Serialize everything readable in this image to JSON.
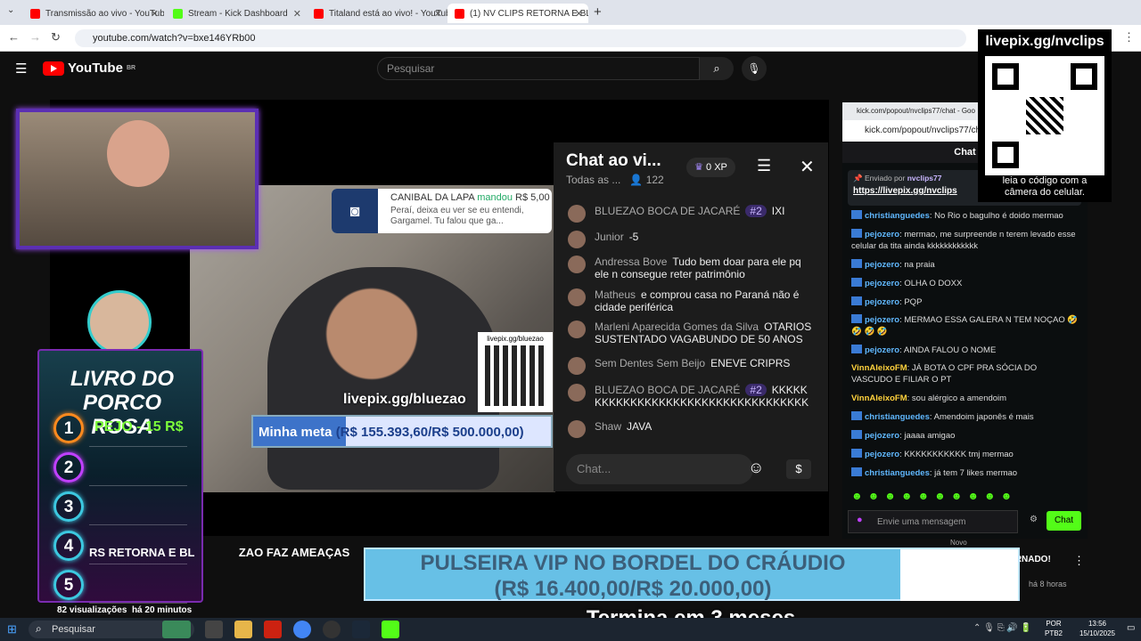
{
  "browser": {
    "tabs": [
      {
        "label": "Transmissão ao vivo - YouTube",
        "color": "#ff0000"
      },
      {
        "label": "Stream - Kick Dashboard",
        "color": "#53fc18"
      },
      {
        "label": "Titaland está ao vivo! - YouTube",
        "color": "#ff0000"
      },
      {
        "label": "(1) NV CLIPS RETORNA E BL",
        "color": "#ff0000"
      }
    ],
    "url": "youtube.com/watch?v=bxe146YRb00"
  },
  "youtube": {
    "logo": "YouTube",
    "region": "BR",
    "search_placeholder": "Pesquisar"
  },
  "video": {
    "donation": {
      "name": "CANIBAL DA LAPA",
      "verb": "mandou",
      "amount": "R$ 5,00",
      "message": "Peraí, deixa eu ver se eu entendi, Gargamel. Tu falou que ga..."
    },
    "livepix_qr_label": "livepix.gg/bluezao",
    "livepix_big": "livepix.gg/bluezao",
    "meta_label": "Minha meta",
    "meta_value": "(R$ 155.393,60/R$ 500.000,00)",
    "meta_progress": 0.31
  },
  "overlay_chat": {
    "title": "Chat ao vi...",
    "subtitle": "Todas as ...",
    "viewers": "122",
    "xp": "0 XP",
    "input_placeholder": "Chat...",
    "messages": [
      {
        "name": "BLUEZAO BOCA DE JACARÉ",
        "badge": "#2",
        "text": "IXI"
      },
      {
        "name": "Junior",
        "text": "-5"
      },
      {
        "name": "Andressa Bove",
        "text": "Tudo bem doar para ele pq ele n consegue reter patrimônio"
      },
      {
        "name": "Matheus",
        "text": "e comprou casa no Paraná não é cidade periférica"
      },
      {
        "name": "Marleni Aparecida Gomes da Silva",
        "text": "OTARIOS SUSTENTADO VAGABUNDO DE 50 ANOS"
      },
      {
        "name": "Sem Dentes Sem Beijo",
        "text": "ENEVE CRIPRS"
      },
      {
        "name": "BLUEZAO BOCA DE JACARÉ",
        "badge": "#2",
        "text": "KKKKK KKKKKKKKKKKKKKKKKKKKKKKKKKKKKK"
      },
      {
        "name": "Shaw",
        "text": "JAVA"
      }
    ]
  },
  "livro": {
    "title_line1": "LIVRO DO PORCO",
    "title_line2": "ROSA",
    "ranks": [
      {
        "n": "1",
        "label": "PEJO - 15 R$",
        "color": "#ff8a1e"
      },
      {
        "n": "2",
        "label": "",
        "color": "#c040ff"
      },
      {
        "n": "3",
        "label": "",
        "color": "#3cc8e0"
      },
      {
        "n": "4",
        "label": "",
        "color": "#3cc8e0"
      },
      {
        "n": "5",
        "label": "",
        "color": "#3cc8e0"
      }
    ]
  },
  "kick": {
    "url_small": "kick.com/popout/nvclips77/chat - Goo",
    "url": "kick.com/popout/nvclips77/cha",
    "chat_header": "Chat",
    "pinned_by": "Enviado por",
    "pinned_user": "nvclips77",
    "pinned_link": "https://livepix.gg/nvclips",
    "messages": [
      {
        "user": "christianguedes",
        "color": "#60b8ff",
        "text": "No Rio o bagulho é doido mermao"
      },
      {
        "user": "pejozero",
        "color": "#60b8ff",
        "text": "mermao, me surpreende n terem levado esse celular da tita ainda kkkkkkkkkkkk"
      },
      {
        "user": "pejozero",
        "color": "#60b8ff",
        "text": "na praia"
      },
      {
        "user": "pejozero",
        "color": "#60b8ff",
        "text": "OLHA O DOXX"
      },
      {
        "user": "pejozero",
        "color": "#60b8ff",
        "text": "PQP"
      },
      {
        "user": "pejozero",
        "color": "#60b8ff",
        "text": "MERMAO ESSA GALERA N TEM NOÇAO 🤣 🤣 🤣 🤣"
      },
      {
        "user": "pejozero",
        "color": "#60b8ff",
        "text": "AINDA FALOU O NOME"
      },
      {
        "user": "VinnAleixoFM",
        "color": "#ffd23c",
        "text": "JÁ BOTA O CPF PRA SÓCIA DO VASCUDO E FILIAR O PT"
      },
      {
        "user": "VinnAleixoFM",
        "color": "#ffd23c",
        "text": "sou alérgico a amendoim"
      },
      {
        "user": "christianguedes",
        "color": "#60b8ff",
        "text": "Amendoim japonês é mais"
      },
      {
        "user": "pejozero",
        "color": "#60b8ff",
        "text": "jaaaa amigao"
      },
      {
        "user": "pejozero",
        "color": "#60b8ff",
        "text": "KKKKKKKKKKK tmj mermao"
      },
      {
        "user": "christianguedes",
        "color": "#60b8ff",
        "text": "já tem 7 likes mermao"
      }
    ],
    "input_placeholder": "Envie uma mensagem",
    "send_label": "Chat"
  },
  "qr_panel": {
    "title": "livepix.gg/nvclips",
    "caption_line1": "leia o código com a",
    "caption_line2": "câmera do celular."
  },
  "banner": {
    "line1": "PULSEIRA VIP NO BORDEL DO CRÁUDIO",
    "line2": "(R$ 16.400,00/R$ 20.000,00)",
    "progress": 0.82,
    "countdown": "Termina em 3 meses"
  },
  "below_video": {
    "title_fragment_1": "RS RETORNA E BL",
    "title_fragment_2": "ZAO FAZ AMEAÇAS",
    "views": "82 visualizações",
    "time": "há 20 minutos",
    "side_title": "TERNADO!",
    "side_time": "há 8 horas",
    "new_badge": "Novo"
  },
  "taskbar": {
    "search": "Pesquisar",
    "lang1": "POR",
    "lang2": "PTB2",
    "time": "13:56",
    "date": "15/10/2025"
  }
}
